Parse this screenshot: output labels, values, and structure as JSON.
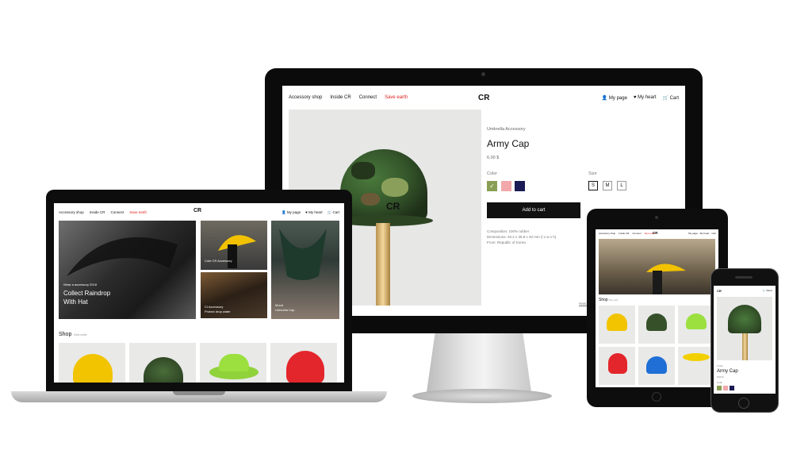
{
  "site": {
    "logo": "CR",
    "nav_links": [
      "Accessory shop",
      "Inside CR",
      "Connect"
    ],
    "nav_highlight": "Save earth",
    "nav_right": [
      "My page",
      "My heart",
      "Cart"
    ]
  },
  "product": {
    "category": "Umbrella Accessory",
    "name": "Army Cap",
    "price": "6.00 $",
    "color_label": "Color",
    "size_label": "Size",
    "colors": [
      "#8a9e53",
      "#f2a8ab",
      "#1b1b55"
    ],
    "sizes": [
      "S",
      "M",
      "L"
    ],
    "add_to_cart": "Add to cart",
    "composition": [
      "Composition: 100% rubber",
      "Dimensions: 40.2 x 36.8 x 40 mm (l x w x h)",
      "From: Republic of Korea"
    ],
    "side_link": "Hand"
  },
  "laptop": {
    "hero_small": "Wear a accessory 2018",
    "hero_title_1": "Collect Raindrop",
    "hero_title_2": "With Hat",
    "tile2_caption": "Cute CR Accessory",
    "tile3_small": "CI Accessory",
    "tile3_caption": "Protect drop water",
    "tile4_small": "Mood",
    "tile4_caption": "Umbrella Cap",
    "shop_title": "Shop",
    "shop_sub": "Best seller"
  },
  "tablet": {
    "shop_title": "Shop",
    "shop_sub": "Best seller"
  },
  "phone": {
    "menu": "Menu",
    "category": "Truck",
    "name": "Army Cap",
    "price": "6.00 $",
    "color_label": "Color"
  },
  "colors": {
    "accent_red": "#e02020",
    "device_black": "#0b0b0b"
  }
}
